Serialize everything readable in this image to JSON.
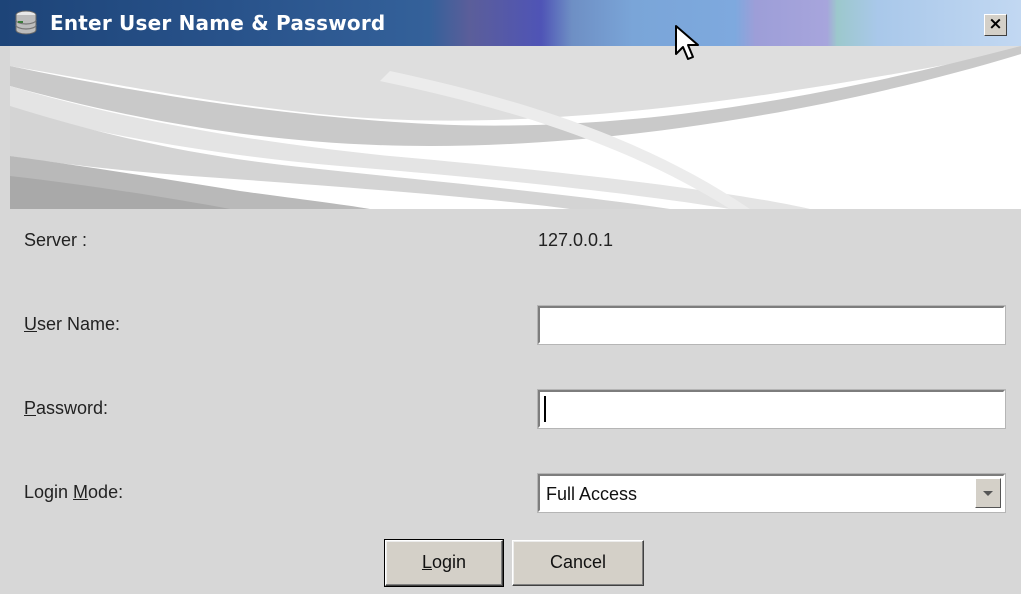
{
  "window": {
    "title": "Enter User Name & Password",
    "close_label": "×",
    "title_icon": "database-icon"
  },
  "form": {
    "server_label": "Server :",
    "server_value": "127.0.0.1",
    "username_label_mnemonic": "U",
    "username_label_rest": "ser Name:",
    "username_value": "",
    "password_label_mnemonic": "P",
    "password_label_rest": "assword:",
    "password_value": "",
    "loginmode_label_pre": "Login ",
    "loginmode_label_mnemonic": "M",
    "loginmode_label_rest": "ode:",
    "loginmode_selected": "Full Access"
  },
  "buttons": {
    "login_mnemonic": "L",
    "login_rest": "ogin",
    "cancel_label": "Cancel"
  },
  "colors": {
    "titlebar_start": "#1d4478",
    "titlebar_end": "#c2d8f2",
    "background": "#d7d7d7"
  }
}
